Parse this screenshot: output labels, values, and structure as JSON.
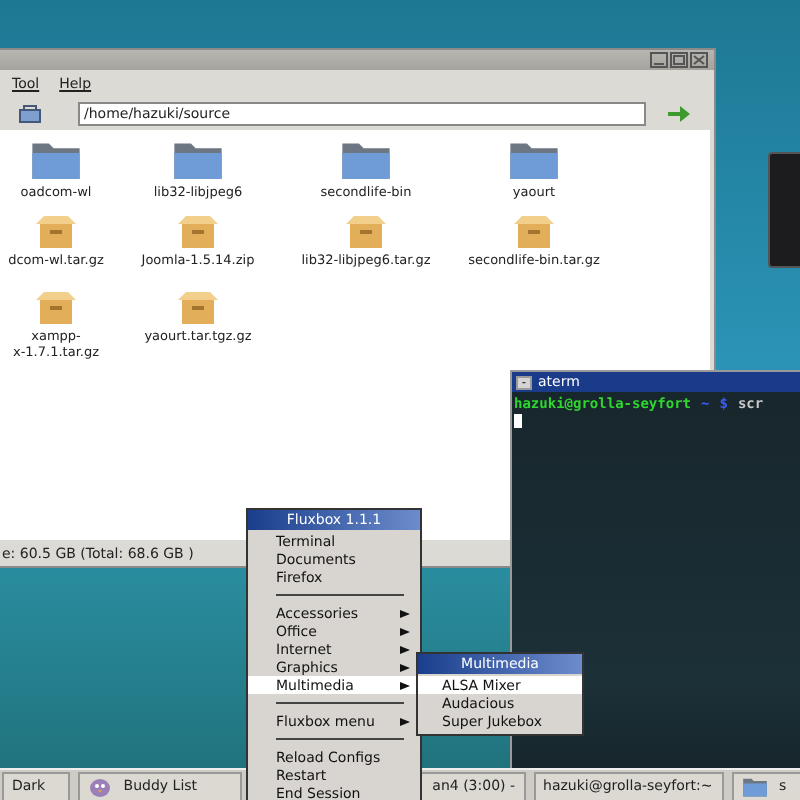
{
  "file_manager": {
    "menu": [
      {
        "label": "Tool"
      },
      {
        "label": "Help"
      }
    ],
    "path": "/home/hazuki/source",
    "files": [
      {
        "kind": "folder",
        "lines": [
          "oadcom-wl"
        ]
      },
      {
        "kind": "folder",
        "lines": [
          "lib32-libjpeg6"
        ]
      },
      {
        "kind": "folder",
        "lines": [
          "secondlife-bin"
        ]
      },
      {
        "kind": "folder",
        "lines": [
          "yaourt"
        ]
      },
      {
        "kind": "archive",
        "lines": [
          "dcom-wl.tar.gz"
        ]
      },
      {
        "kind": "archive",
        "lines": [
          "Joomla-1.5.14.zip"
        ]
      },
      {
        "kind": "archive",
        "lines": [
          "lib32-libjpeg6.tar.gz"
        ]
      },
      {
        "kind": "archive",
        "lines": [
          "secondlife-bin.tar.gz"
        ]
      },
      {
        "kind": "archive",
        "lines": [
          "xampp-",
          "x-1.7.1.tar.gz"
        ]
      },
      {
        "kind": "archive",
        "lines": [
          "yaourt.tar.tgz.gz"
        ]
      }
    ],
    "status": "e: 60.5 GB (Total: 68.6 GB )"
  },
  "terminal": {
    "title": "aterm",
    "minimize": "-",
    "user_host": "hazuki@grolla-seyfort",
    "cwd": "~",
    "prompt": "$",
    "command": "scr"
  },
  "root_menu": {
    "title": "Fluxbox 1.1.1",
    "items": [
      {
        "kind": "item",
        "label": "Terminal",
        "submenu": false,
        "selected": false
      },
      {
        "kind": "item",
        "label": "Documents",
        "submenu": false,
        "selected": false
      },
      {
        "kind": "item",
        "label": "Firefox",
        "submenu": false,
        "selected": false
      },
      {
        "kind": "separator"
      },
      {
        "kind": "item",
        "label": "Accessories",
        "submenu": true,
        "selected": false
      },
      {
        "kind": "item",
        "label": "Office",
        "submenu": true,
        "selected": false
      },
      {
        "kind": "item",
        "label": "Internet",
        "submenu": true,
        "selected": false
      },
      {
        "kind": "item",
        "label": "Graphics",
        "submenu": true,
        "selected": false
      },
      {
        "kind": "item",
        "label": "Multimedia",
        "submenu": true,
        "selected": true
      },
      {
        "kind": "separator"
      },
      {
        "kind": "item",
        "label": "Fluxbox menu",
        "submenu": true,
        "selected": false
      },
      {
        "kind": "separator"
      },
      {
        "kind": "item",
        "label": "Reload Configs",
        "submenu": false,
        "selected": false
      },
      {
        "kind": "item",
        "label": "Restart",
        "submenu": false,
        "selected": false
      },
      {
        "kind": "item",
        "label": "End Session",
        "submenu": false,
        "selected": false
      }
    ]
  },
  "submenu": {
    "title": "Multimedia",
    "items": [
      {
        "label": "ALSA Mixer",
        "selected": true
      },
      {
        "label": "Audacious",
        "selected": false
      },
      {
        "label": "Super Jukebox",
        "selected": false
      }
    ]
  },
  "taskbar": [
    {
      "kind": "plain",
      "label": "Dark"
    },
    {
      "kind": "bird",
      "label": "Buddy List"
    },
    {
      "kind": "plain",
      "label": "an4 (3:00) -"
    },
    {
      "kind": "plain",
      "label": "hazuki@grolla-seyfort:~"
    },
    {
      "kind": "folder",
      "label": "s"
    }
  ]
}
